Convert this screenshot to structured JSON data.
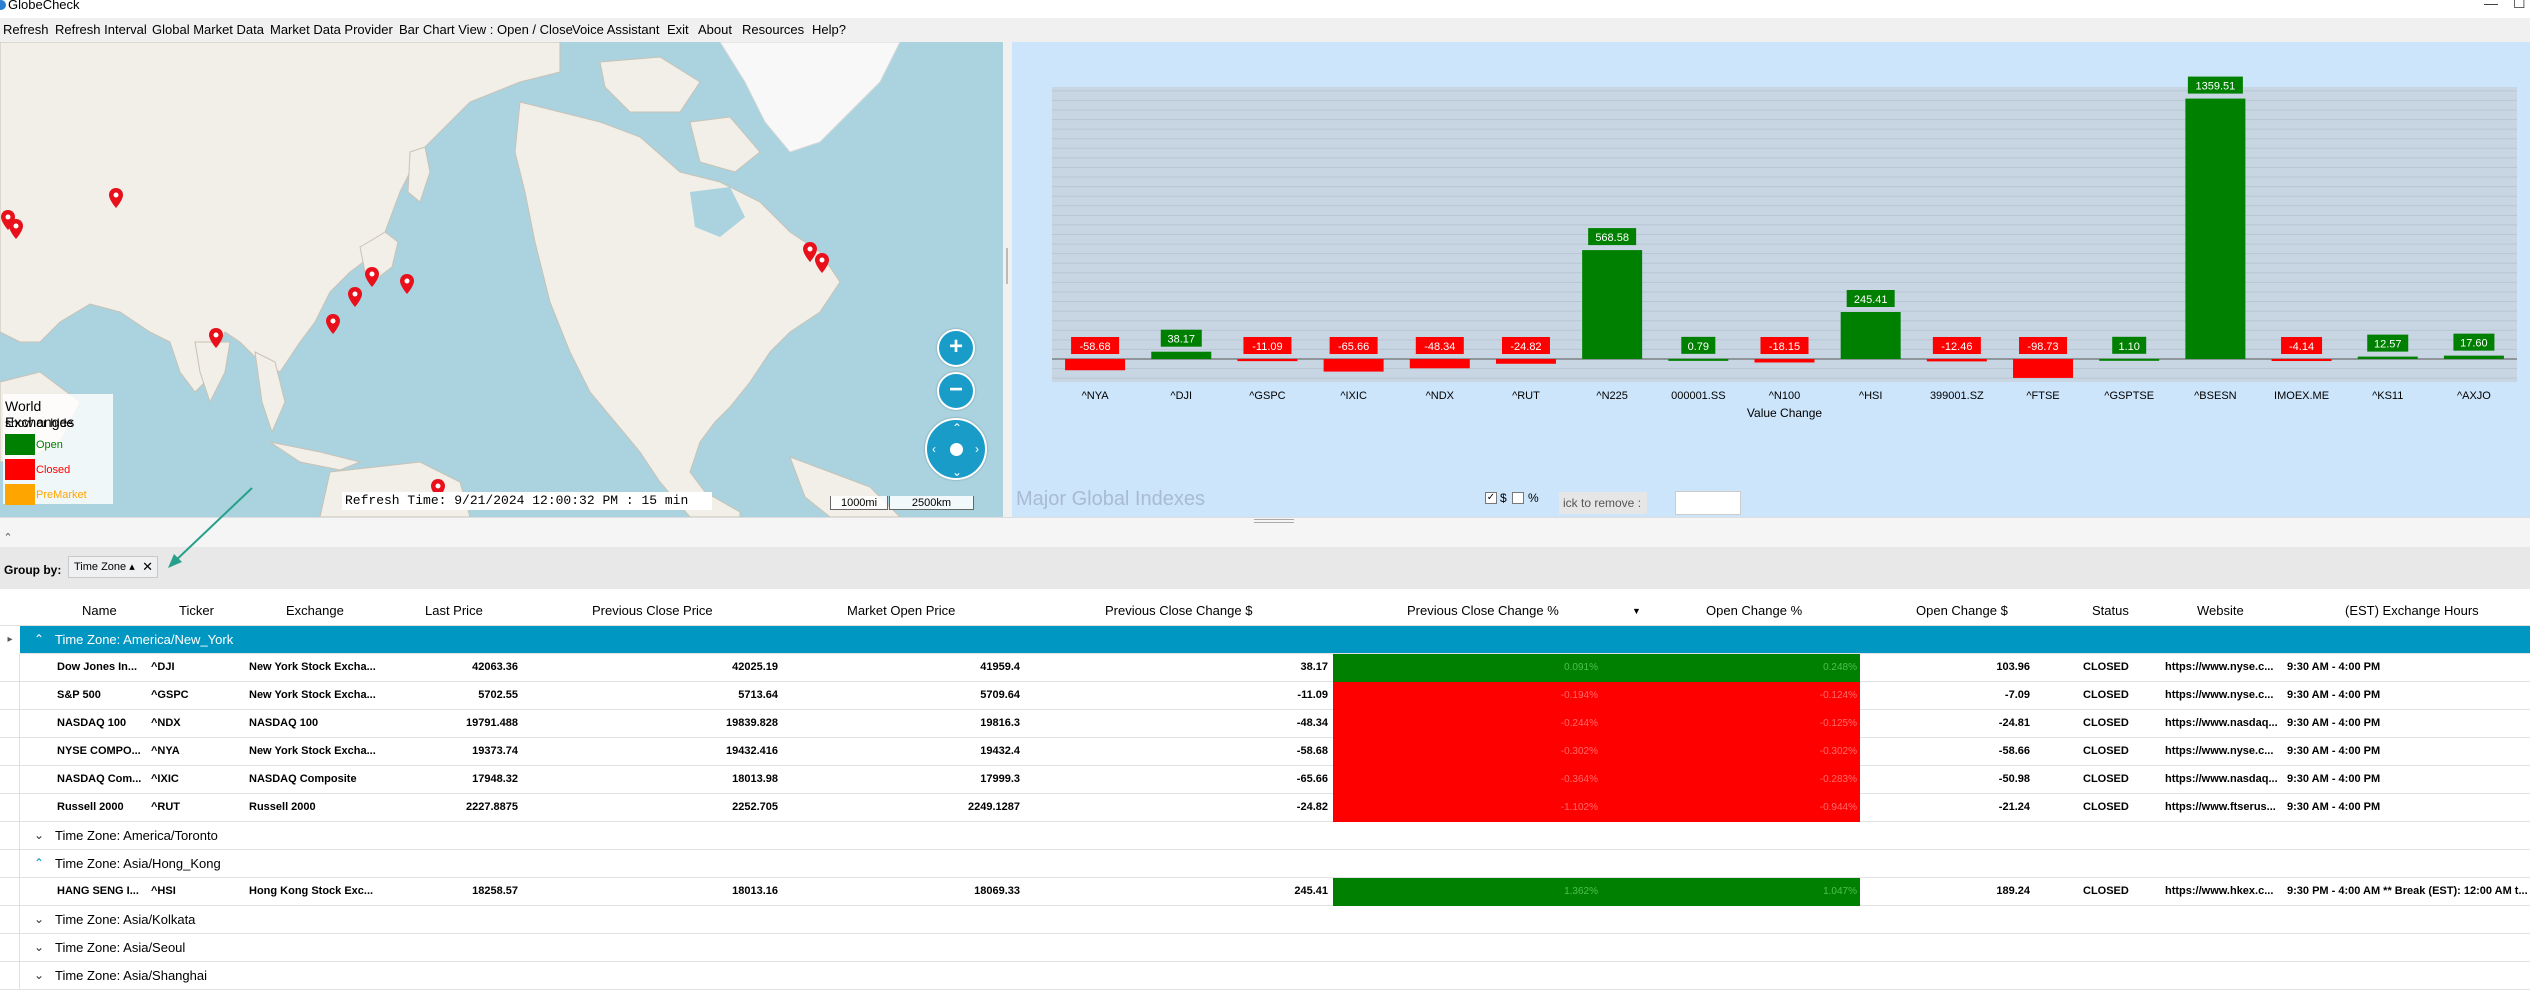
{
  "window": {
    "title": "GlobeCheck",
    "minimize": "—",
    "maximize": "☐"
  },
  "menu": [
    "Refresh",
    "Refresh Interval",
    "Global Market Data",
    "Market Data Provider",
    "Bar Chart View : Open / Close",
    "Voice Assistant",
    "Exit",
    "About",
    "Resources",
    "Help?"
  ],
  "map": {
    "legend": {
      "title": "World Exchanges",
      "subtitle": "show or hide",
      "open": "Open",
      "closed": "Closed",
      "premarket": "PreMarket"
    },
    "zoom_in": "+",
    "zoom_out": "−",
    "refresh_text": "Refresh Time: 9/21/2024 12:00:32 PM : 15 min",
    "scale_mi": "1000mi",
    "scale_km": "2500km",
    "colors": {
      "open": "#008000",
      "closed": "#ff0000",
      "premarket": "#ffa500",
      "pin": "#e8101a",
      "water": "#aad3df",
      "land": "#f2efe9"
    }
  },
  "chart_data": {
    "type": "bar",
    "title": "",
    "xlabel": "Value Change",
    "ylabel": "",
    "watermark": "Major Global Indexes",
    "categories": [
      "^NYA",
      "^DJI",
      "^GSPC",
      "^IXIC",
      "^NDX",
      "^RUT",
      "^N225",
      "000001.SS",
      "^N100",
      "^HSI",
      "399001.SZ",
      "^FTSE",
      "^GSPTSE",
      "^BSESN",
      "IMOEX.ME",
      "^KS11",
      "^AXJO"
    ],
    "values": [
      -58.68,
      38.17,
      -11.09,
      -65.66,
      -48.34,
      -24.82,
      568.58,
      0.79,
      -18.15,
      245.41,
      -12.46,
      -98.73,
      1.1,
      1359.51,
      -4.14,
      12.57,
      17.6
    ],
    "labels": [
      "-58.68",
      "38.17",
      "-11.09",
      "-65.66",
      "-48.34",
      "-24.82",
      "568.58",
      "0.79",
      "-18.15",
      "245.41",
      "-12.46",
      "-98.73",
      "1.10",
      "1359.51",
      "-4.14",
      "12.57",
      "17.60"
    ],
    "ylim": [
      -120,
      1420
    ],
    "grid": true,
    "colors": {
      "positive": "#008000",
      "negative": "#ff0000",
      "plot_bg": "#c8d6e4",
      "panel_bg": "#cce5fb"
    }
  },
  "chart_controls": {
    "dollar_label": "$",
    "percent_label": "%",
    "dollar_checked": "✓",
    "remove_placeholder": "ick to remove :"
  },
  "groupby": {
    "label": "Group by:",
    "chip": "Time Zone ▴",
    "chip_close": "✕"
  },
  "grid": {
    "columns": [
      "Name",
      "Ticker",
      "Exchange",
      "Last Price",
      "Previous Close Price",
      "Market Open Price",
      "Previous Close Change $",
      "Previous Close Change %",
      "Open Change %",
      "Open Change $",
      "Status",
      "Website",
      "(EST) Exchange Hours"
    ],
    "sort_indicator": "▼",
    "groups": [
      {
        "title": "Time Zone: America/New_York",
        "expanded": true,
        "selected": true,
        "rows": [
          {
            "name": "Dow Jones In...",
            "ticker": "^DJI",
            "exchange": "New York Stock Excha...",
            "last": "42063.36",
            "prev": "42025.19",
            "open": "41959.4",
            "chg": "38.17",
            "chgpct": "0.091%",
            "openpct": "0.248%",
            "openchg": "103.96",
            "status": "CLOSED",
            "web": "https://www.nyse.c...",
            "hours": "9:30 AM - 4:00 PM",
            "positive": true
          },
          {
            "name": "S&P 500",
            "ticker": "^GSPC",
            "exchange": "New York Stock Excha...",
            "last": "5702.55",
            "prev": "5713.64",
            "open": "5709.64",
            "chg": "-11.09",
            "chgpct": "-0.194%",
            "openpct": "-0.124%",
            "openchg": "-7.09",
            "status": "CLOSED",
            "web": "https://www.nyse.c...",
            "hours": "9:30 AM - 4:00 PM",
            "positive": false
          },
          {
            "name": "NASDAQ 100",
            "ticker": "^NDX",
            "exchange": "NASDAQ 100",
            "last": "19791.488",
            "prev": "19839.828",
            "open": "19816.3",
            "chg": "-48.34",
            "chgpct": "-0.244%",
            "openpct": "-0.125%",
            "openchg": "-24.81",
            "status": "CLOSED",
            "web": "https://www.nasdaq...",
            "hours": "9:30 AM - 4:00 PM",
            "positive": false
          },
          {
            "name": "NYSE COMPO...",
            "ticker": "^NYA",
            "exchange": "New York Stock Excha...",
            "last": "19373.74",
            "prev": "19432.416",
            "open": "19432.4",
            "chg": "-58.68",
            "chgpct": "-0.302%",
            "openpct": "-0.302%",
            "openchg": "-58.66",
            "status": "CLOSED",
            "web": "https://www.nyse.c...",
            "hours": "9:30 AM - 4:00 PM",
            "positive": false
          },
          {
            "name": "NASDAQ Com...",
            "ticker": "^IXIC",
            "exchange": "NASDAQ Composite",
            "last": "17948.32",
            "prev": "18013.98",
            "open": "17999.3",
            "chg": "-65.66",
            "chgpct": "-0.364%",
            "openpct": "-0.283%",
            "openchg": "-50.98",
            "status": "CLOSED",
            "web": "https://www.nasdaq...",
            "hours": "9:30 AM - 4:00 PM",
            "positive": false
          },
          {
            "name": "Russell 2000",
            "ticker": "^RUT",
            "exchange": "Russell 2000",
            "last": "2227.8875",
            "prev": "2252.705",
            "open": "2249.1287",
            "chg": "-24.82",
            "chgpct": "-1.102%",
            "openpct": "-0.944%",
            "openchg": "-21.24",
            "status": "CLOSED",
            "web": "https://www.ftserus...",
            "hours": "9:30 AM - 4:00 PM",
            "positive": false
          }
        ]
      },
      {
        "title": "Time Zone: America/Toronto",
        "expanded": false,
        "rows": []
      },
      {
        "title": "Time Zone: Asia/Hong_Kong",
        "expanded": true,
        "rows": [
          {
            "name": "HANG SENG I...",
            "ticker": "^HSI",
            "exchange": "Hong Kong Stock Exc...",
            "last": "18258.57",
            "prev": "18013.16",
            "open": "18069.33",
            "chg": "245.41",
            "chgpct": "1.362%",
            "openpct": "1.047%",
            "openchg": "189.24",
            "status": "CLOSED",
            "web": "https://www.hkex.c...",
            "hours": "9:30 PM - 4:00 AM ** Break (EST): 12:00 AM t...",
            "positive": true
          }
        ]
      },
      {
        "title": "Time Zone: Asia/Kolkata",
        "expanded": false,
        "rows": []
      },
      {
        "title": "Time Zone: Asia/Seoul",
        "expanded": false,
        "rows": []
      },
      {
        "title": "Time Zone: Asia/Shanghai",
        "expanded": false,
        "rows": []
      }
    ]
  }
}
